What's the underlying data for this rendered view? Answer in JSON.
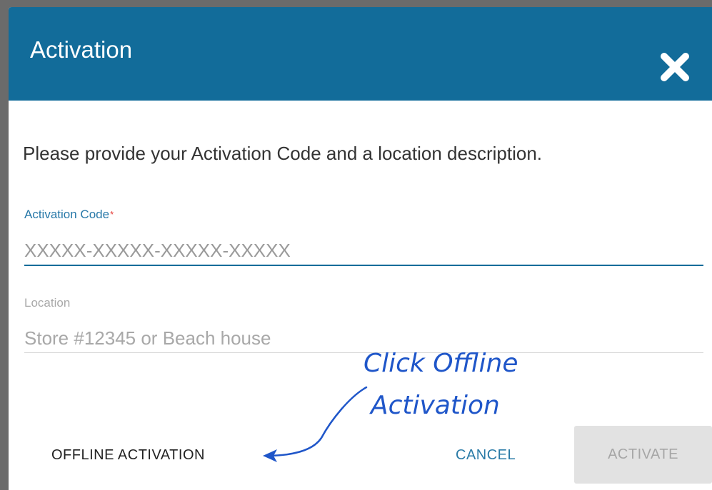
{
  "dialog": {
    "title": "Activation",
    "close_icon": "close-icon"
  },
  "instructions": "Please provide your Activation Code and a location description.",
  "activation_code": {
    "label": "Activation Code",
    "required_marker": "*",
    "placeholder": "XXXXX-XXXXX-XXXXX-XXXXX",
    "value": ""
  },
  "location": {
    "label": "Location",
    "placeholder": "Store #12345 or Beach house",
    "value": ""
  },
  "buttons": {
    "offline": "OFFLINE ACTIVATION",
    "cancel": "CANCEL",
    "activate": "ACTIVATE"
  },
  "annotation": {
    "line1": "Click Offline",
    "line2": "Activation"
  },
  "colors": {
    "header": "#126c9a",
    "accent": "#2778a8",
    "annotation": "#1f56c9",
    "required": "#e53935",
    "backdrop": "#6b6b6b"
  }
}
